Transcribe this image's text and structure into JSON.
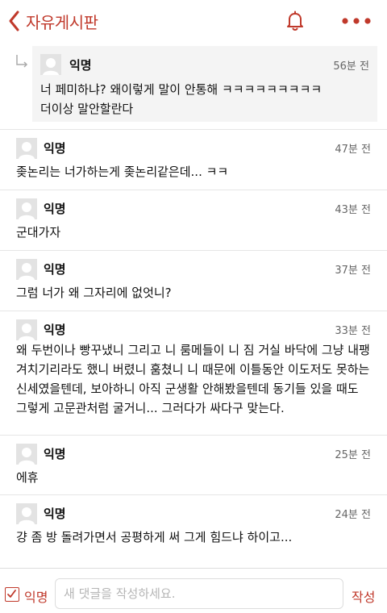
{
  "header": {
    "title": "자유게시판",
    "back_icon": "chevron-left-icon",
    "notification_icon": "bell-icon",
    "more_icon": "more-dots-icon",
    "accent_color": "#c0392b"
  },
  "reply": {
    "author": "익명",
    "time": "56분 전",
    "text": "너 페미하냐? 왜이렇게 말이 안통해 ㅋㅋㅋㅋㅋㅋㅋㅋㅋ\n더이상 말안할란다"
  },
  "comments": [
    {
      "author": "익명",
      "time": "47분 전",
      "text": "좆논리는 너가하는게 좆논리같은데... ㅋㅋ"
    },
    {
      "author": "익명",
      "time": "43분 전",
      "text": "군대가자"
    },
    {
      "author": "익명",
      "time": "37분 전",
      "text": "그럼 너가 왜 그자리에 없엇니?"
    },
    {
      "author": "익명",
      "time": "33분 전",
      "text": "왜 두번이나 빵꾸냈니 그리고 니 룸메들이 니 짐 거실 바닥에 그냥 내팽겨치기리라도 했니 버렸니 훔쳤니 니 때문에 이틀동안 이도저도 못하는 신세였을텐데, 보아하니 아직 군생활 안해봤을텐데 동기들 있을 때도 그렇게 고문관처럼 굴거니... 그러다가 싸다구 맞는다."
    },
    {
      "author": "익명",
      "time": "25분 전",
      "text": "에휴"
    },
    {
      "author": "익명",
      "time": "24분 전",
      "text": "걍 좀 방 돌려가면서 공평하게 써 그게 힘드냐 하이고..."
    }
  ],
  "compose": {
    "anonymous_label": "익명",
    "anonymous_checked": true,
    "placeholder": "새 댓글을 작성하세요.",
    "submit_label": "작성"
  }
}
